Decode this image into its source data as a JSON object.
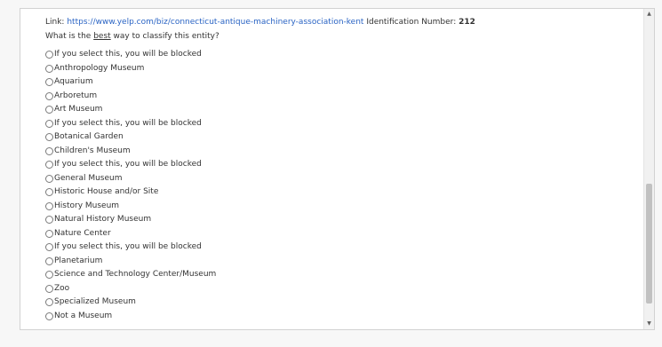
{
  "header": {
    "link_label": "Link:",
    "link_url": "https://www.yelp.com/biz/connecticut-antique-machinery-association-kent",
    "id_label": "Identification Number:",
    "id_value": "212"
  },
  "question": {
    "prefix": "What is the",
    "emphasis": "best",
    "suffix": "way to classify this entity?"
  },
  "options": [
    "If you select this, you will be blocked",
    "Anthropology Museum",
    "Aquarium",
    "Arboretum",
    "Art Museum",
    "If you select this, you will be blocked",
    "Botanical Garden",
    "Children's Museum",
    "If you select this, you will be blocked",
    "General Museum",
    "Historic House and/or Site",
    "History Museum",
    "Natural History Museum",
    "Nature Center",
    "If you select this, you will be blocked",
    "Planetarium",
    "Science and Technology Center/Museum",
    "Zoo",
    "Specialized Museum",
    "Not a Museum"
  ],
  "colors": {
    "link": "#2a64c4",
    "text": "#333333"
  },
  "icons": {
    "scroll_up": "triangle-up-icon",
    "scroll_down": "triangle-down-icon"
  }
}
